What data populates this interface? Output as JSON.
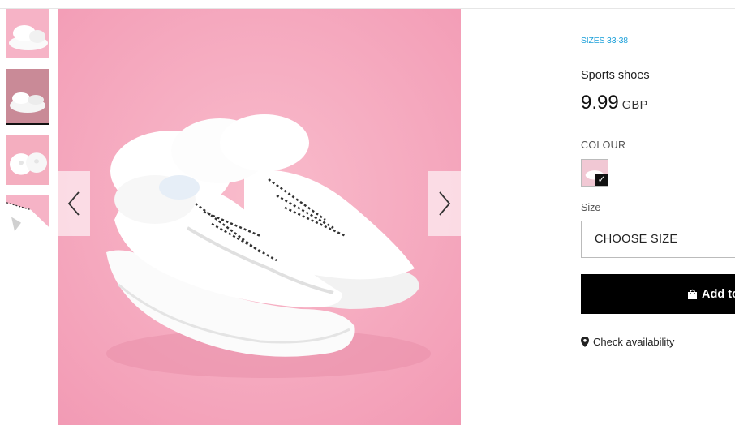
{
  "gallery": {
    "thumbnails": [
      "thumb-1",
      "thumb-2",
      "thumb-3",
      "thumb-4"
    ],
    "active_index": 1,
    "prev_icon": "chevron-left-icon",
    "next_icon": "chevron-right-icon"
  },
  "product": {
    "sizes_range": "SIZES 33-38",
    "name": "Sports shoes",
    "price_value": "9.99",
    "price_currency": "GBP",
    "colour_label": "COLOUR",
    "size_label": "Size",
    "size_placeholder": "CHOOSE SIZE",
    "add_button": "Add to",
    "check_availability": "Check availability"
  },
  "colors": {
    "accent": "#1a9fd9",
    "button_bg": "#000000",
    "image_bg": "#f7aabf"
  }
}
